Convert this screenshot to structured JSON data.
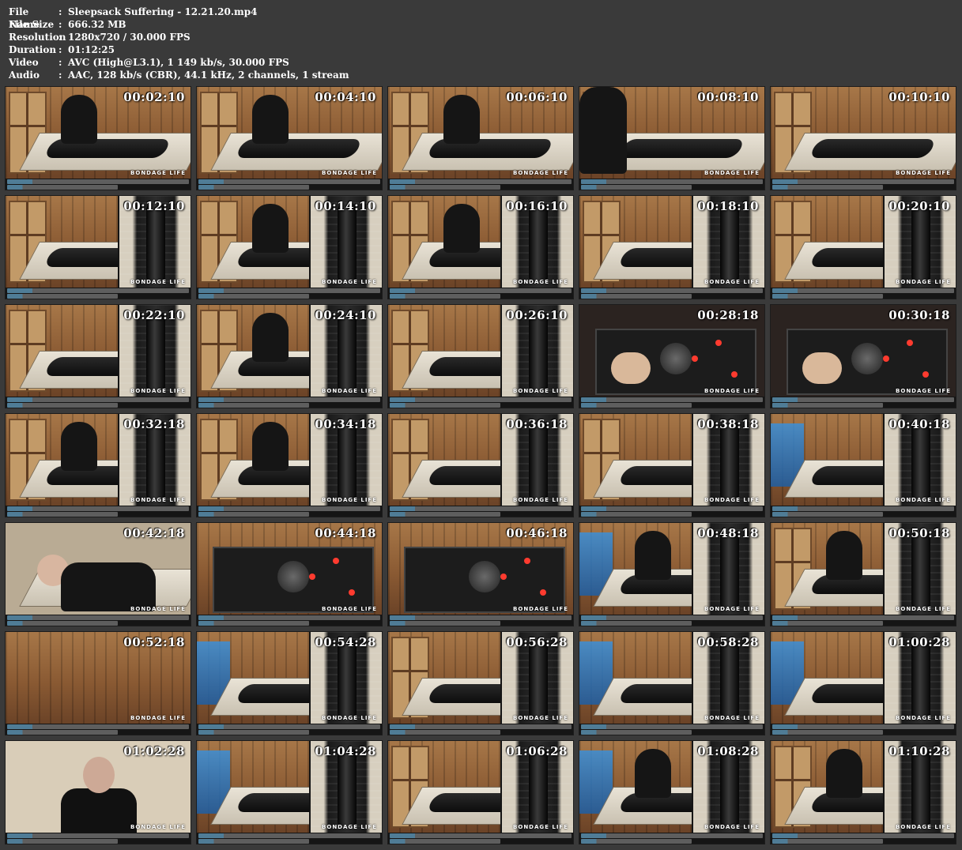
{
  "file_info": [
    {
      "label": "File Name",
      "sep": ":",
      "value": "Sleepsack Suffering - 12.21.20.mp4"
    },
    {
      "label": "File Size",
      "sep": ":",
      "value": "666.32 MB"
    },
    {
      "label": "Resolution",
      "sep": ":",
      "value": "1280x720 / 30.000 FPS"
    },
    {
      "label": "Duration",
      "sep": ":",
      "value": "01:12:25"
    },
    {
      "label": "Video",
      "sep": ":",
      "value": "AVC (High@L3.1), 1 149 kb/s, 30.000 FPS"
    },
    {
      "label": "Audio",
      "sep": ":",
      "value": "AAC, 128 kb/s (CBR), 44.1 kHz, 2 channels, 1 stream"
    }
  ],
  "watermark": "BONDAGE LIFE",
  "thumbnails": [
    {
      "time": "00:02:10",
      "scene": "room-worker"
    },
    {
      "time": "00:04:10",
      "scene": "room-worker"
    },
    {
      "time": "00:06:10",
      "scene": "room-worker"
    },
    {
      "time": "00:08:10",
      "scene": "room-closeup"
    },
    {
      "time": "00:10:10",
      "scene": "room"
    },
    {
      "time": "00:12:10",
      "scene": "split"
    },
    {
      "time": "00:14:10",
      "scene": "split-worker"
    },
    {
      "time": "00:16:10",
      "scene": "split-worker"
    },
    {
      "time": "00:18:10",
      "scene": "split"
    },
    {
      "time": "00:20:10",
      "scene": "split"
    },
    {
      "time": "00:22:10",
      "scene": "split"
    },
    {
      "time": "00:24:10",
      "scene": "split-worker"
    },
    {
      "time": "00:26:10",
      "scene": "split"
    },
    {
      "time": "00:28:18",
      "scene": "control"
    },
    {
      "time": "00:30:18",
      "scene": "control"
    },
    {
      "time": "00:32:18",
      "scene": "split-worker"
    },
    {
      "time": "00:34:18",
      "scene": "split-worker"
    },
    {
      "time": "00:36:18",
      "scene": "split"
    },
    {
      "time": "00:38:18",
      "scene": "split"
    },
    {
      "time": "00:40:18",
      "scene": "split-blue"
    },
    {
      "time": "00:42:18",
      "scene": "bald"
    },
    {
      "time": "00:44:18",
      "scene": "machine"
    },
    {
      "time": "00:46:18",
      "scene": "machine"
    },
    {
      "time": "00:48:18",
      "scene": "split-blue-worker"
    },
    {
      "time": "00:50:18",
      "scene": "split-worker"
    },
    {
      "time": "00:52:18",
      "scene": "corner"
    },
    {
      "time": "00:54:28",
      "scene": "split-blue"
    },
    {
      "time": "00:56:28",
      "scene": "split"
    },
    {
      "time": "00:58:28",
      "scene": "split-blue"
    },
    {
      "time": "01:00:28",
      "scene": "split-blue"
    },
    {
      "time": "01:02:28",
      "scene": "topdown"
    },
    {
      "time": "01:04:28",
      "scene": "split-blue"
    },
    {
      "time": "01:06:28",
      "scene": "split"
    },
    {
      "time": "01:08:28",
      "scene": "split-blue-worker"
    },
    {
      "time": "01:10:28",
      "scene": "split-worker"
    }
  ]
}
